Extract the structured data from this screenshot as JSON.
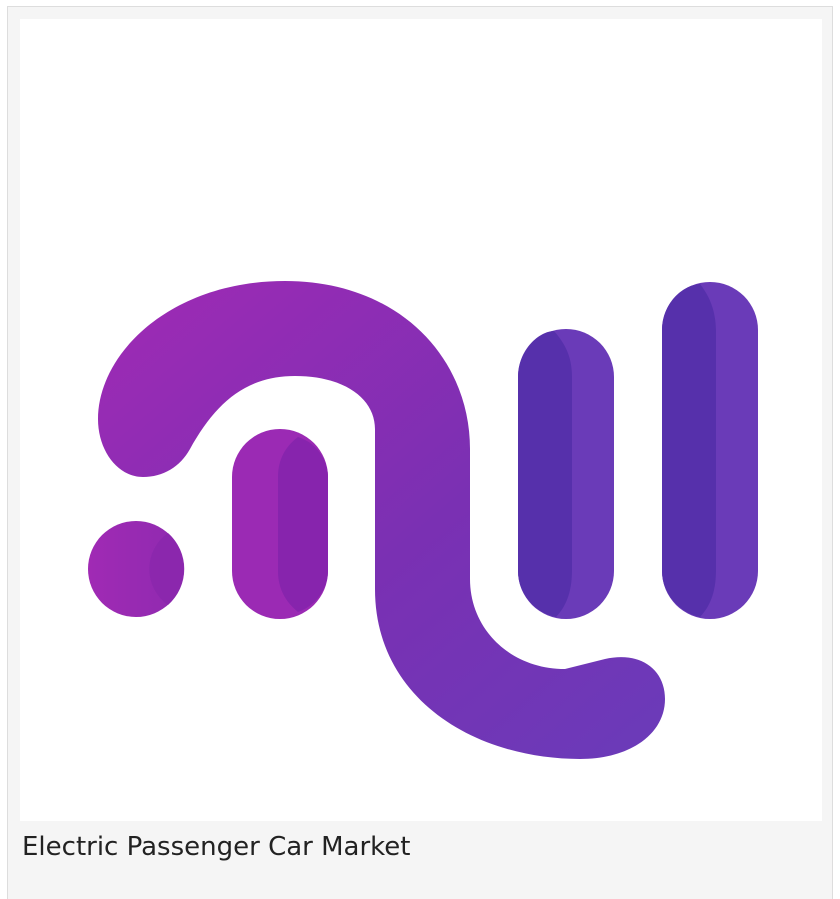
{
  "card": {
    "caption": "Electric Passenger Car Market"
  },
  "logo": {
    "icon": "brand-logo-icon",
    "colors": {
      "magenta": "#9b2bb3",
      "purple": "#7a2fb0",
      "violet": "#6a3bb8",
      "violet_dark": "#5b31ad"
    }
  }
}
